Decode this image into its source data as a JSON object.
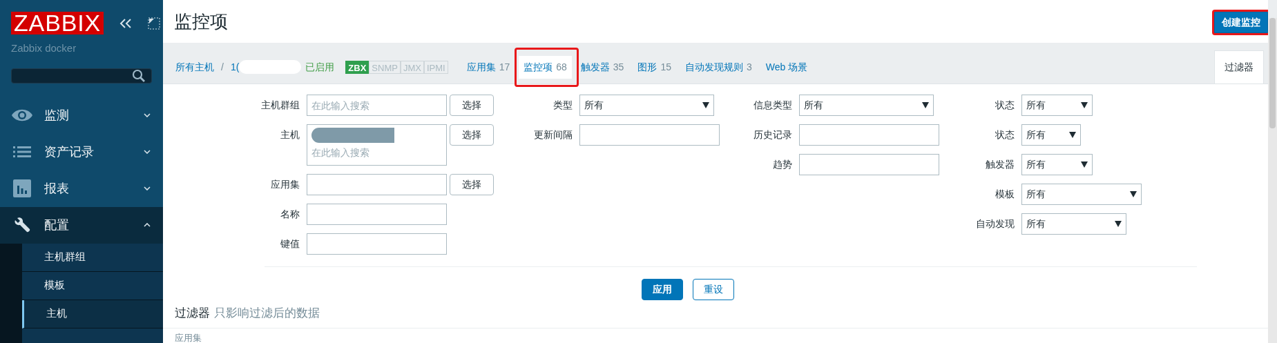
{
  "sidebar": {
    "logo": "ZABBIX",
    "server_name": "Zabbix docker",
    "menu": [
      {
        "kind": "eye",
        "label": "监测",
        "expanded": false
      },
      {
        "kind": "list",
        "label": "资产记录",
        "expanded": false
      },
      {
        "kind": "chart",
        "label": "报表",
        "expanded": false
      },
      {
        "kind": "wrench",
        "label": "配置",
        "expanded": true,
        "children": [
          {
            "label": "主机群组",
            "selected": false
          },
          {
            "label": "模板",
            "selected": false
          },
          {
            "label": "主机",
            "selected": true
          }
        ]
      }
    ]
  },
  "header": {
    "title": "监控项",
    "create_button": {
      "label": "创建监控",
      "highlighted": true
    }
  },
  "breadcrumb": {
    "path": [
      "所有主机",
      "1("
    ],
    "separator": "/",
    "status": "已启用",
    "availability": [
      {
        "label": "ZBX",
        "on": true
      },
      {
        "label": "SNMP",
        "on": false
      },
      {
        "label": "JMX",
        "on": false
      },
      {
        "label": "IPMI",
        "on": false
      }
    ],
    "tabs": [
      {
        "label": "应用集",
        "count": "17",
        "selected": false,
        "highlighted": false
      },
      {
        "label": "监控项",
        "count": "68",
        "selected": true,
        "highlighted": true
      },
      {
        "label": "触发器",
        "count": "35",
        "selected": false,
        "highlighted": false
      },
      {
        "label": "图形",
        "count": "15",
        "selected": false,
        "highlighted": false
      },
      {
        "label": "自动发现规则",
        "count": "3",
        "selected": false,
        "highlighted": false
      },
      {
        "label": "Web 场景",
        "selected": false,
        "highlighted": false
      }
    ],
    "filter_tab": "过滤器"
  },
  "filter": {
    "columns": [
      {
        "fields": [
          {
            "kind": "multiselect",
            "label": "主机群组",
            "placeholder": "在此输入搜索",
            "button": "选择"
          },
          {
            "kind": "multiselect",
            "label": "主机",
            "placeholder": "在此输入搜索",
            "button": "选择",
            "has_chip": true
          },
          {
            "kind": "text",
            "label": "应用集",
            "button": "选择"
          },
          {
            "kind": "text",
            "label": "名称"
          },
          {
            "kind": "text",
            "label": "键值"
          }
        ]
      },
      {
        "fields": [
          {
            "kind": "select",
            "label": "类型",
            "value": "所有"
          },
          {
            "kind": "text",
            "label": "更新间隔"
          }
        ]
      },
      {
        "fields": [
          {
            "kind": "select",
            "label": "信息类型",
            "value": "所有"
          },
          {
            "kind": "text",
            "label": "历史记录"
          },
          {
            "kind": "text",
            "label": "趋势"
          }
        ]
      },
      {
        "fields": [
          {
            "kind": "select",
            "label": "状态",
            "value": "所有"
          },
          {
            "kind": "select",
            "label": "状态",
            "value": "所有"
          },
          {
            "kind": "select",
            "label": "触发器",
            "value": "所有"
          },
          {
            "kind": "select",
            "label": "模板",
            "value": "所有"
          },
          {
            "kind": "select",
            "label": "自动发现",
            "value": "所有"
          }
        ]
      }
    ],
    "actions": [
      {
        "label": "应用",
        "kind": "primary"
      },
      {
        "label": "重设",
        "kind": "secondary"
      }
    ]
  },
  "filter_note": {
    "title": "过滤器",
    "text": "只影响过滤后的数据"
  },
  "table": {
    "group_label": "应用集"
  }
}
